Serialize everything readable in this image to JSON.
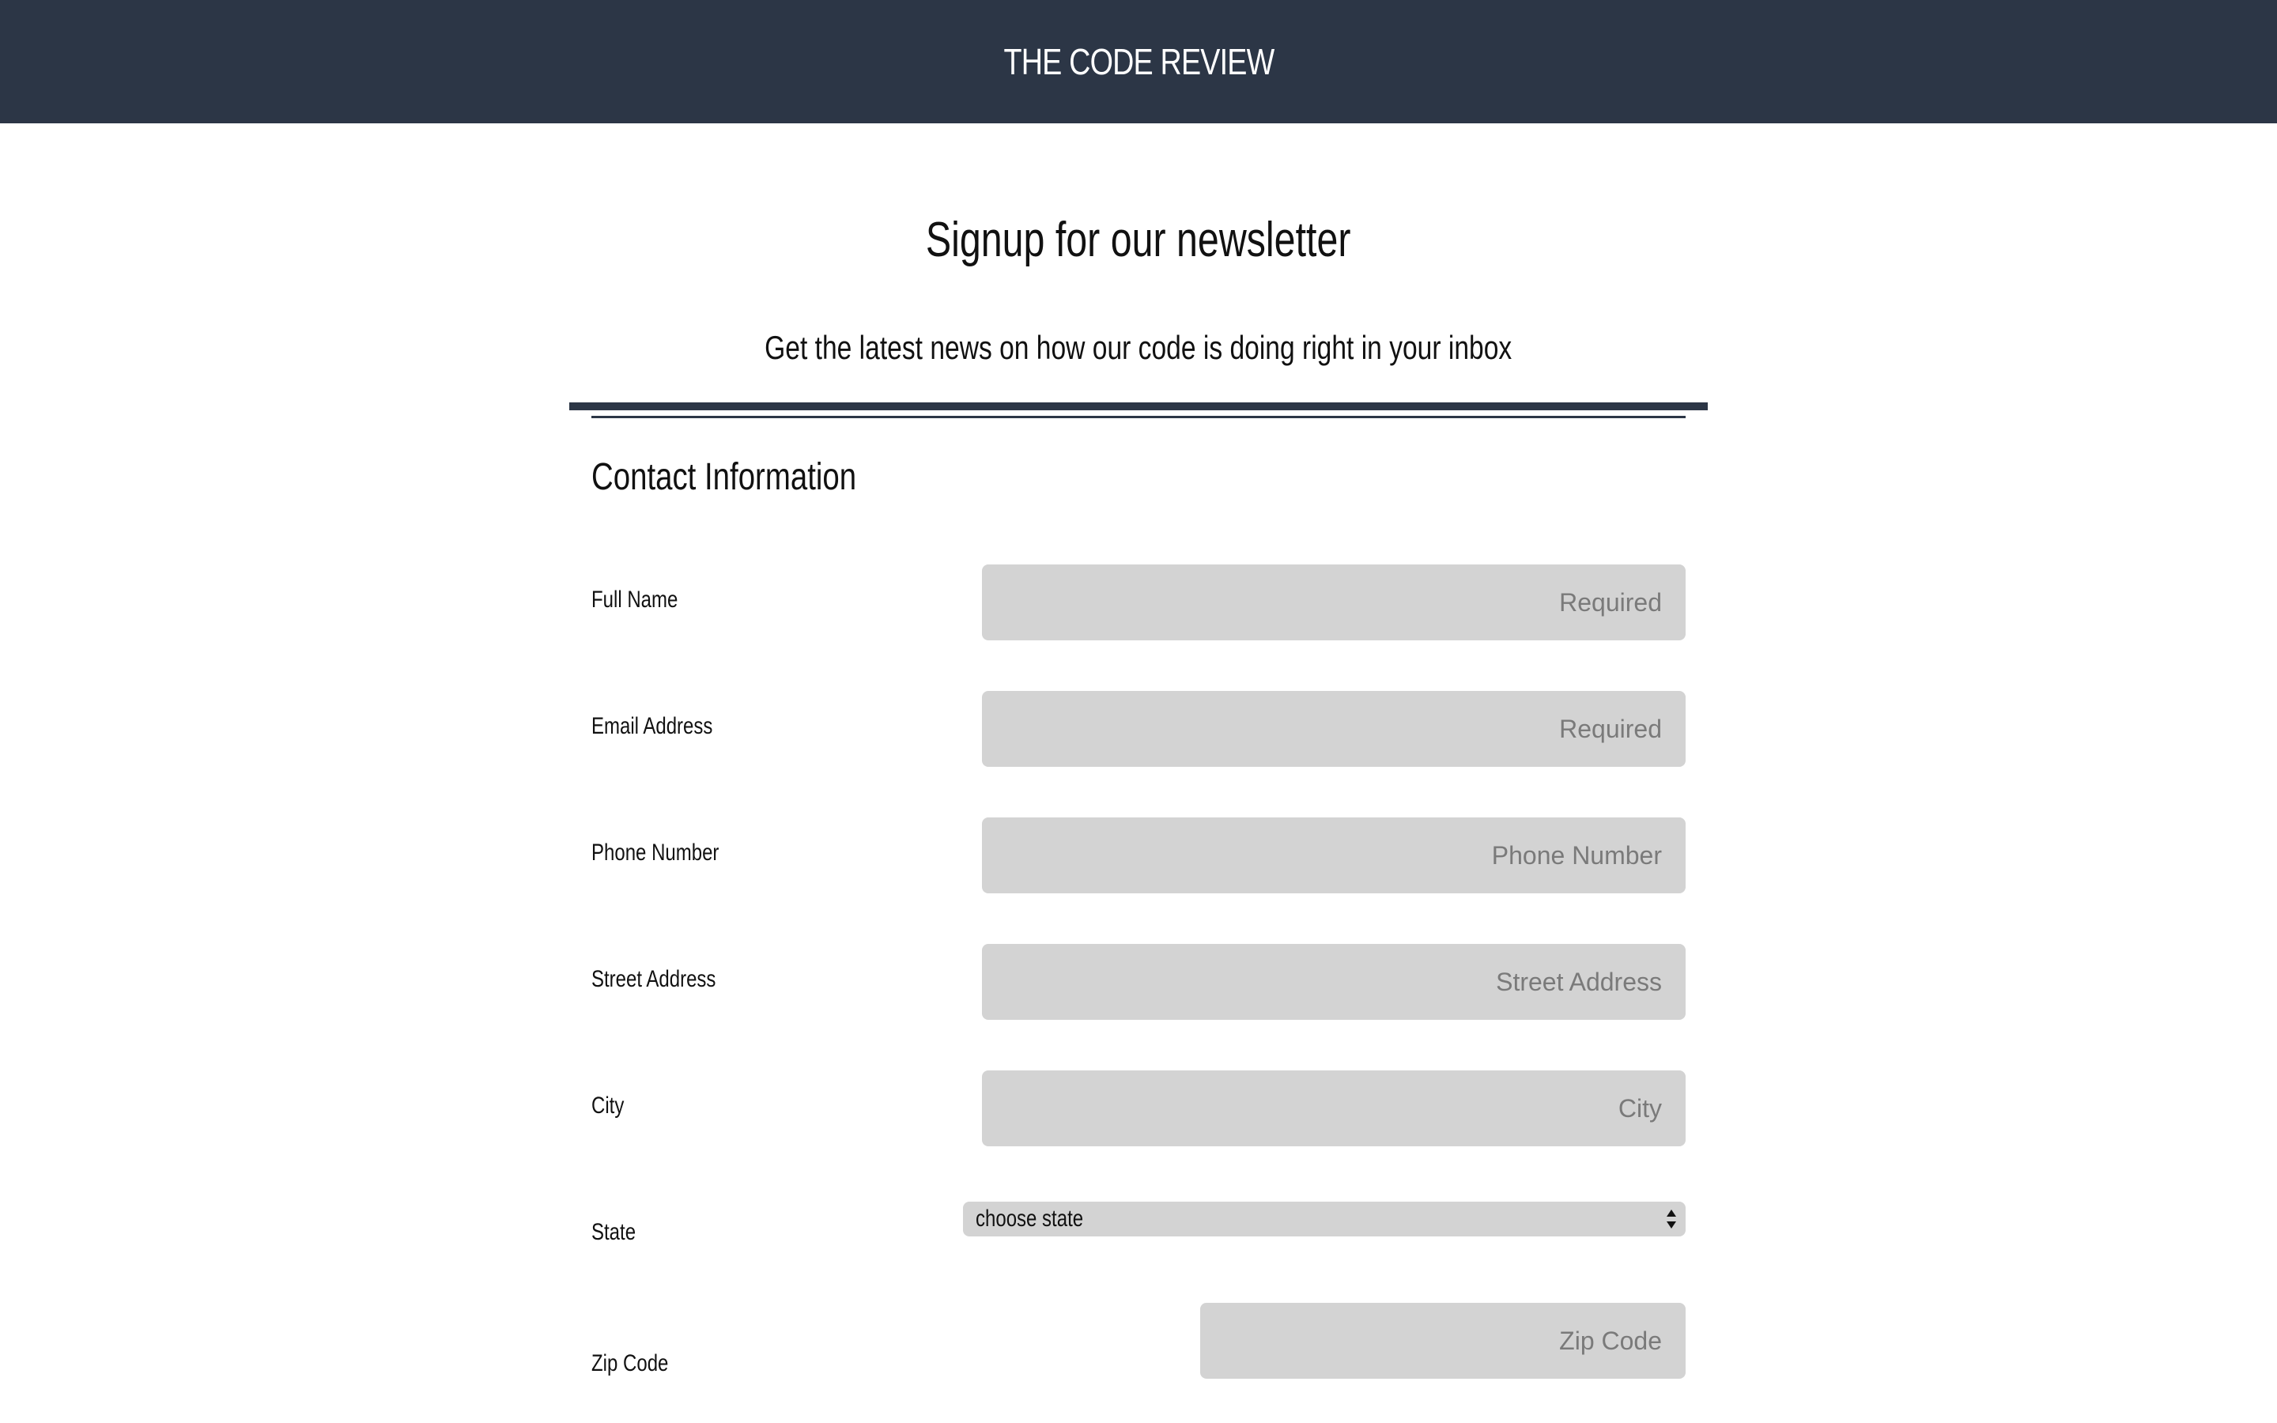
{
  "header": {
    "site_title": "THE CODE REVIEW"
  },
  "intro": {
    "title": "Signup for our newsletter",
    "subtitle": "Get the latest news on how our code is doing right in your inbox"
  },
  "form": {
    "section_title": "Contact Information",
    "fields": [
      {
        "label": "Full Name",
        "placeholder": "Required"
      },
      {
        "label": "Email Address",
        "placeholder": "Required"
      },
      {
        "label": "Phone Number",
        "placeholder": "Phone Number"
      },
      {
        "label": "Street Address",
        "placeholder": "Street Address"
      },
      {
        "label": "City",
        "placeholder": "City"
      }
    ],
    "state": {
      "label": "State",
      "selected": "choose state"
    },
    "zip": {
      "label": "Zip Code",
      "placeholder": "Zip Code"
    }
  },
  "colors": {
    "header_bg": "#2c3646",
    "field_bg": "#d3d3d3"
  }
}
